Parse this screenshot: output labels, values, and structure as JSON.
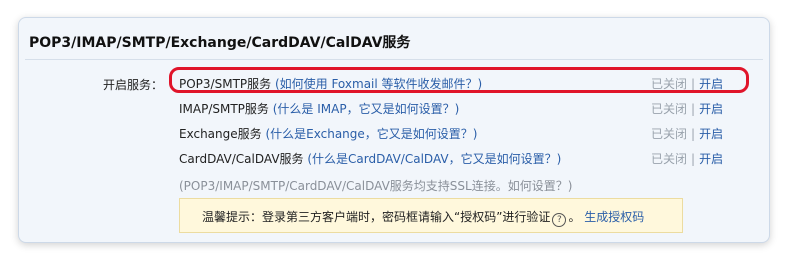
{
  "panel": {
    "title": "POP3/IMAP/SMTP/Exchange/CardDAV/CalDAV服务"
  },
  "services": {
    "label": "开启服务：",
    "items": [
      {
        "name": "POP3/SMTP服务",
        "open_paren": " (",
        "help": "如何使用 Foxmail 等软件收发邮件？",
        "close_paren": ")",
        "status": "已关闭",
        "sep": "|",
        "action": "开启"
      },
      {
        "name": "IMAP/SMTP服务",
        "open_paren": " (",
        "help": "什么是 IMAP，它又是如何设置？",
        "close_paren": ")",
        "status": "已关闭",
        "sep": "|",
        "action": "开启"
      },
      {
        "name": "Exchange服务",
        "open_paren": " (",
        "help": "什么是Exchange，它又是如何设置？",
        "close_paren": ")",
        "status": "已关闭",
        "sep": "|",
        "action": "开启"
      },
      {
        "name": "CardDAV/CalDAV服务",
        "open_paren": " (",
        "help": "什么是CardDAV/CalDAV，它又是如何设置？",
        "close_paren": ")",
        "status": "已关闭",
        "sep": "|",
        "action": "开启"
      }
    ],
    "ssl_note": {
      "prefix": "(POP3/IMAP/SMTP/CardDAV/CalDAV服务均支持SSL连接。",
      "link": "如何设置？",
      "suffix": ")"
    }
  },
  "tip": {
    "text": "温馨提示：登录第三方客户端时，密码框请输入“授权码”进行验证",
    "help_icon": "question-circle-icon",
    "help_glyph": "?",
    "period": "。",
    "link": "生成授权码"
  },
  "colors": {
    "highlight": "#e0142a",
    "link": "#2a5ea8",
    "tip_bg": "#fff8dc"
  }
}
